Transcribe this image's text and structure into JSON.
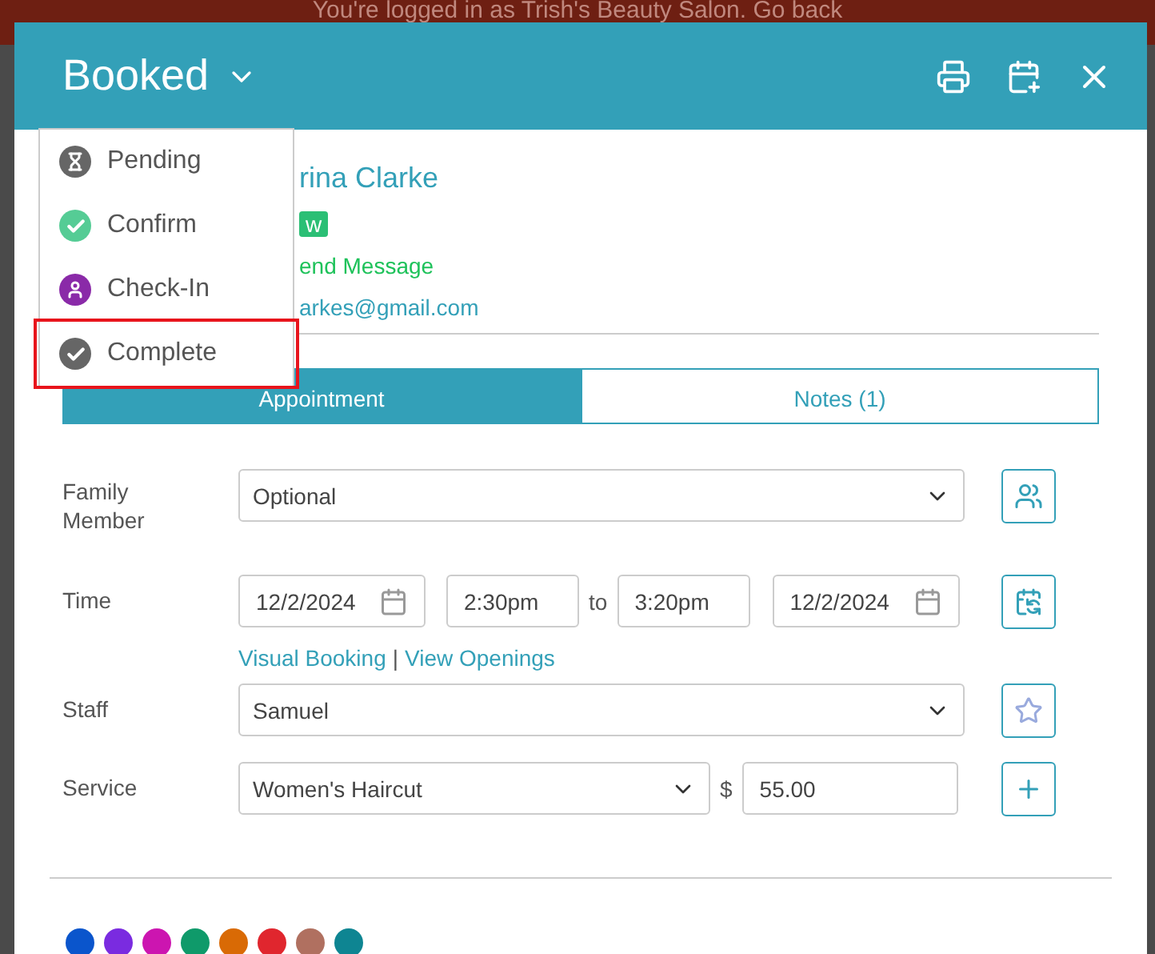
{
  "banner": {
    "text": "You're logged in as Trish's Beauty Salon. Go back"
  },
  "modal": {
    "title": "Booked"
  },
  "status_menu": [
    {
      "label": "Pending",
      "kind": "pending",
      "selected": false
    },
    {
      "label": "Confirm",
      "kind": "confirm",
      "selected": false
    },
    {
      "label": "Check-In",
      "kind": "checkin",
      "selected": false
    },
    {
      "label": "Complete",
      "kind": "complete",
      "selected": true
    }
  ],
  "client": {
    "name": "rina Clarke",
    "badge": "w",
    "message_link": "end Message",
    "email": "arkes@gmail.com"
  },
  "tabs": [
    {
      "label": "Appointment",
      "selected": true
    },
    {
      "label": "Notes (1)",
      "selected": false
    }
  ],
  "family_member": {
    "label": "Family Member",
    "value": "Optional"
  },
  "time": {
    "label": "Time",
    "start_date": "12/2/2024",
    "start_time": "2:30pm",
    "separator": "to",
    "end_time": "3:20pm",
    "end_date": "12/2/2024",
    "links": [
      "Visual Booking",
      "View Openings"
    ],
    "link_separator": "|"
  },
  "staff": {
    "label": "Staff",
    "value": "Samuel"
  },
  "service": {
    "label": "Service",
    "value": "Women's Haircut",
    "currency": "$",
    "price": "55.00"
  },
  "colors": [
    {
      "color": "#0a55cc"
    },
    {
      "color": "#7a2be0"
    },
    {
      "color": "#cc15b0"
    },
    {
      "color": "#0f9a6a"
    },
    {
      "color": "#d96a05"
    },
    {
      "color": "#e0262e"
    },
    {
      "color": "#b07060"
    },
    {
      "color": "#0e8592"
    }
  ]
}
